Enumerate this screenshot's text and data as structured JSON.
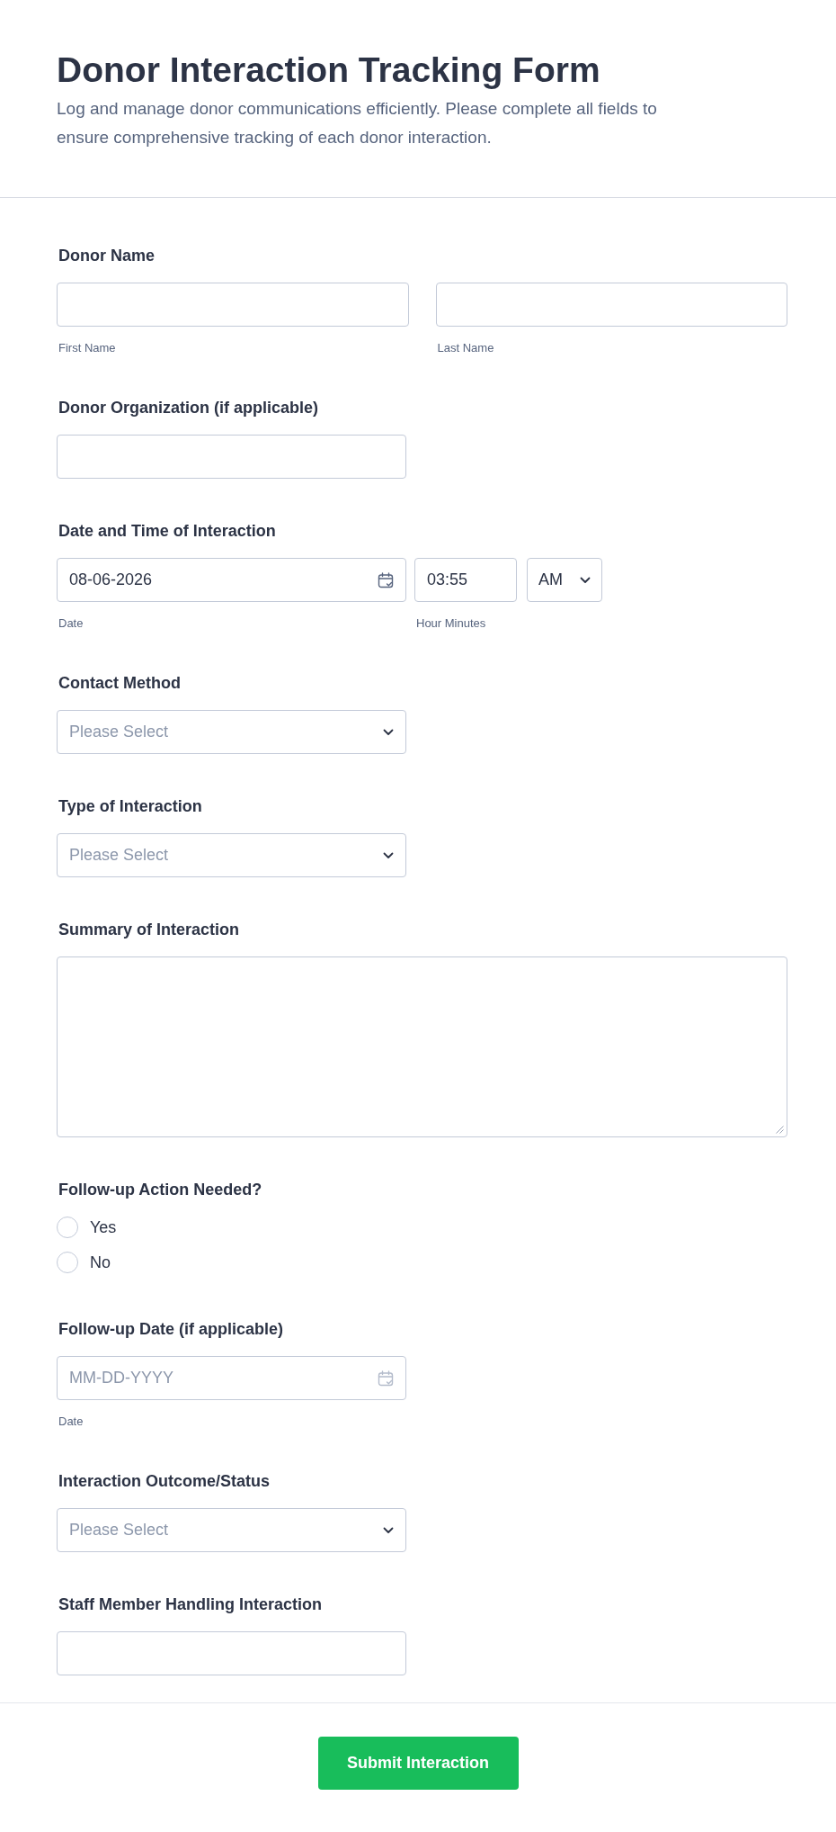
{
  "header": {
    "title": "Donor Interaction Tracking Form",
    "description": "Log and manage donor communications efficiently. Please complete all fields to ensure comprehensive tracking of each donor interaction."
  },
  "fields": [
    {
      "kind": "name",
      "label": "Donor Name",
      "inputs": [
        {
          "sublabel": "First Name"
        },
        {
          "sublabel": "Last Name"
        }
      ]
    },
    {
      "kind": "text",
      "label": "Donor Organization (if applicable)"
    },
    {
      "kind": "datetime",
      "label": "Date and Time of Interaction",
      "date": {
        "value": "08-06-2026",
        "sublabel": "Date"
      },
      "time": {
        "value": "03:55",
        "sublabel": "Hour Minutes"
      },
      "period": {
        "value": "AM"
      }
    },
    {
      "kind": "select",
      "label": "Contact Method",
      "placeholder": "Please Select"
    },
    {
      "kind": "select",
      "label": "Type of Interaction",
      "placeholder": "Please Select"
    },
    {
      "kind": "textarea",
      "label": "Summary of Interaction"
    },
    {
      "kind": "radio",
      "label": "Follow-up Action Needed?",
      "options": [
        {
          "label": "Yes",
          "selected": false
        },
        {
          "label": "No",
          "selected": false
        }
      ]
    },
    {
      "kind": "date",
      "label": "Follow-up Date (if applicable)",
      "placeholder": "MM-DD-YYYY",
      "sublabel": "Date"
    },
    {
      "kind": "select",
      "label": "Interaction Outcome/Status",
      "placeholder": "Please Select"
    },
    {
      "kind": "text",
      "label": "Staff Member Handling Interaction"
    }
  ],
  "submit_button": {
    "label": "Submit Interaction"
  }
}
